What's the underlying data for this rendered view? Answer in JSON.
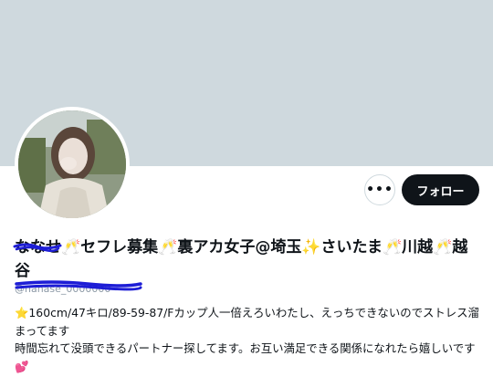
{
  "profile": {
    "display_name": "ななせ🥂セフレ募集🥂裏アカ女子@埼玉✨さいたま🥂川越🥂越谷",
    "handle": "@nanase_0000000",
    "bio": "⭐160cm/47キロ/89-59-87/Fカップ人一倍えろいわたし、えっちできないのでストレス溜まってます\n時間忘れて没頭できるパートナー探してます。お互い満足できる関係になれたら嬉しいです💕"
  },
  "actions": {
    "more_label": "•••",
    "follow_label": "フォロー"
  },
  "colors": {
    "banner": "#cfd9de",
    "follow_button_bg": "#0f1419",
    "redaction": "#1d1dd6"
  }
}
